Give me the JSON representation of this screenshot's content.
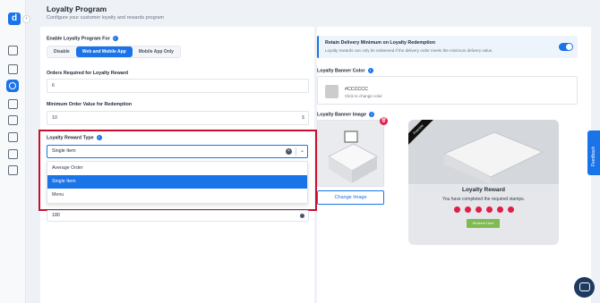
{
  "brand": {
    "logo_letter": "d",
    "accent": "#1a73e8",
    "highlight_border": "#c8102e"
  },
  "sidebar": {
    "collapse_glyph": "›",
    "icons": [
      "building-icon",
      "storefront-icon",
      "loyalty-icon",
      "orders-icon",
      "media-icon",
      "reports-icon",
      "integrations-icon",
      "settings-icon"
    ]
  },
  "header": {
    "title": "Loyalty Program",
    "subtitle": "Configure your customer loyalty and rewards program"
  },
  "enable": {
    "label": "Enable Loyalty Program For",
    "options": [
      "Disable",
      "Web and Mobile App",
      "Mobile App Only"
    ],
    "selected": "Web and Mobile App"
  },
  "orders_required": {
    "label": "Orders Required for Loyalty Reward",
    "value": "6"
  },
  "min_order": {
    "label": "Minimum Order Value for Redemption",
    "value": "10",
    "suffix": "$"
  },
  "reward_type": {
    "label": "Loyalty Reward Type",
    "value": "Single Item",
    "options": [
      "Average Order",
      "Single Item",
      "Menu"
    ],
    "selected": "Single Item"
  },
  "points_field": {
    "value": "180"
  },
  "retain": {
    "title": "Retain Delivery Minimum on Loyalty Redemption",
    "description": "Loyalty rewards can only be redeemed if the delivery order meets the minimum delivery value.",
    "enabled": true
  },
  "banner_color": {
    "label": "Loyalty Banner Color",
    "hex": "#CCCCCC",
    "hint": "Click to change color",
    "swatch": "#cccccc"
  },
  "banner_image": {
    "label": "Loyalty Banner Image",
    "change_label": "Change Image",
    "trash_glyph": "🗑"
  },
  "preview": {
    "ribbon": "Preview",
    "title": "Loyalty Reward",
    "subtitle": "You have completed the required stamps.",
    "stamp_count": 6,
    "redeem_label": "Redeem Here"
  },
  "feedback_label": "Feedback"
}
